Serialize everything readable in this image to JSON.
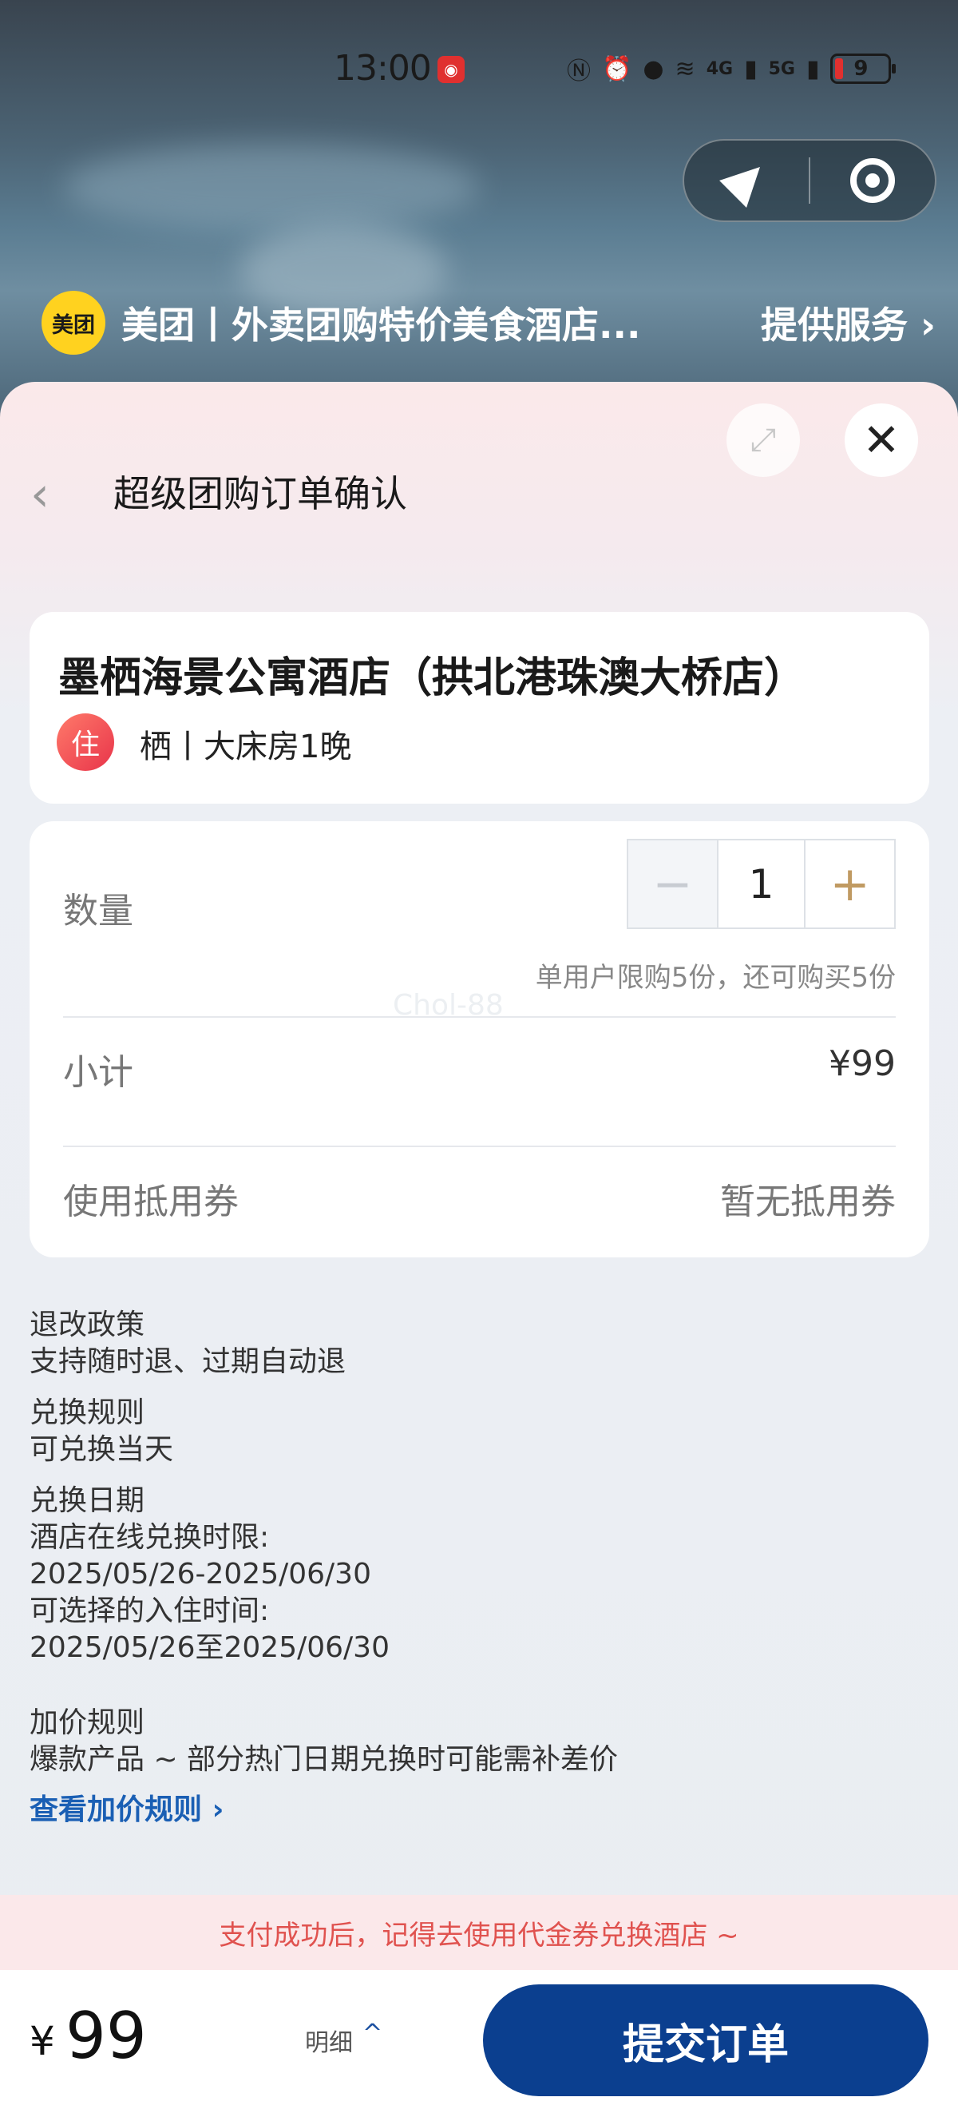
{
  "status_bar": {
    "time": "13:00",
    "battery": "9",
    "signal_labels": [
      "4G",
      "5G"
    ]
  },
  "mini_program": {
    "provider_logo": "美团",
    "provider_name": "美团丨外卖团购特价美食酒店...",
    "provider_link": "提供服务",
    "capsule_icons": [
      "location-arrow-icon",
      "target-circle-icon"
    ]
  },
  "sheet": {
    "title": "超级团购订单确认",
    "expand_icon": "expand-icon",
    "close_icon": "close-icon"
  },
  "hotel": {
    "name": "墨栖海景公寓酒店（拱北港珠澳大桥店）",
    "tag": "住",
    "room": "栖丨大床房1晚"
  },
  "order": {
    "quantity_label": "数量",
    "quantity_value": "1",
    "minus": "−",
    "plus": "+",
    "limit_text": "单用户限购5份，还可购买5份",
    "watermark": "Chol-88",
    "subtotal_label": "小计",
    "subtotal_value": "¥99",
    "coupon_label": "使用抵用券",
    "coupon_value": "暂无抵用券"
  },
  "policies": {
    "refund_title": "退改政策",
    "refund_text": "支持随时退、过期自动退",
    "exchange_rule_title": "兑换规则",
    "exchange_rule_text": "可兑换当天",
    "exchange_date_title": "兑换日期",
    "exchange_date_line1": "酒店在线兑换时限:",
    "exchange_date_line2": "2025/05/26-2025/06/30",
    "exchange_date_line3": "可选择的入住时间:",
    "exchange_date_line4": "2025/05/26至2025/06/30",
    "surcharge_title": "加价规则",
    "surcharge_text": "爆款产品 ~ 部分热门日期兑换时可能需补差价",
    "surcharge_link": "查看加价规则"
  },
  "notice": "支付成功后，记得去使用代金券兑换酒店 ~",
  "footer": {
    "currency": "¥",
    "price": "99",
    "detail_label": "明细",
    "submit_label": "提交订单"
  },
  "colors": {
    "primary": "#0b3f8f",
    "accent_gold": "#c09a62",
    "notice_red": "#e0524f",
    "link_blue": "#1a5fb4"
  }
}
